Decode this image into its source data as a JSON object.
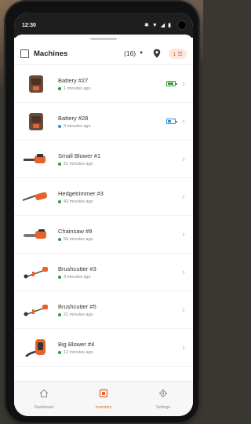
{
  "statusbar": {
    "time": "12:30"
  },
  "header": {
    "title": "Machines",
    "count": "(16)",
    "filter_count": "1"
  },
  "machines": [
    {
      "name": "Battery #27",
      "sub": "1 minutes ago",
      "dot": "green",
      "icon": "battery-pack-icon",
      "battery": {
        "color": "#2e9a3a",
        "level": 0.9
      }
    },
    {
      "name": "Battery #28",
      "sub": "3 minutes ago",
      "dot": "blue",
      "icon": "battery-pack-icon",
      "battery": {
        "color": "#2a8fd6",
        "level": 0.5
      }
    },
    {
      "name": "Small Blower #1",
      "sub": "21 minutes ago",
      "dot": "green",
      "icon": "leaf-blower-icon"
    },
    {
      "name": "Hedgetrimmer #3",
      "sub": "43 minutes ago",
      "dot": "green",
      "icon": "hedge-trimmer-icon"
    },
    {
      "name": "Chainsaw #8",
      "sub": "56 minutes ago",
      "dot": "green",
      "icon": "chainsaw-icon"
    },
    {
      "name": "Brushcutter #3",
      "sub": "3 minutes ago",
      "dot": "green",
      "icon": "brushcutter-icon"
    },
    {
      "name": "Brushcutter #5",
      "sub": "21 minutes ago",
      "dot": "green",
      "icon": "brushcutter-icon"
    },
    {
      "name": "Big Blower #4",
      "sub": "12 minutes ago",
      "dot": "green",
      "icon": "backpack-blower-icon"
    }
  ],
  "nav": [
    {
      "label": "Dashboard",
      "icon": "home-icon",
      "active": false
    },
    {
      "label": "Inventory",
      "icon": "inventory-icon",
      "active": true
    },
    {
      "label": "Settings",
      "icon": "gear-icon",
      "active": false
    }
  ],
  "colors": {
    "accent": "#e8632b",
    "online": "#2e9a3a",
    "status_blue": "#2a8fd6"
  }
}
